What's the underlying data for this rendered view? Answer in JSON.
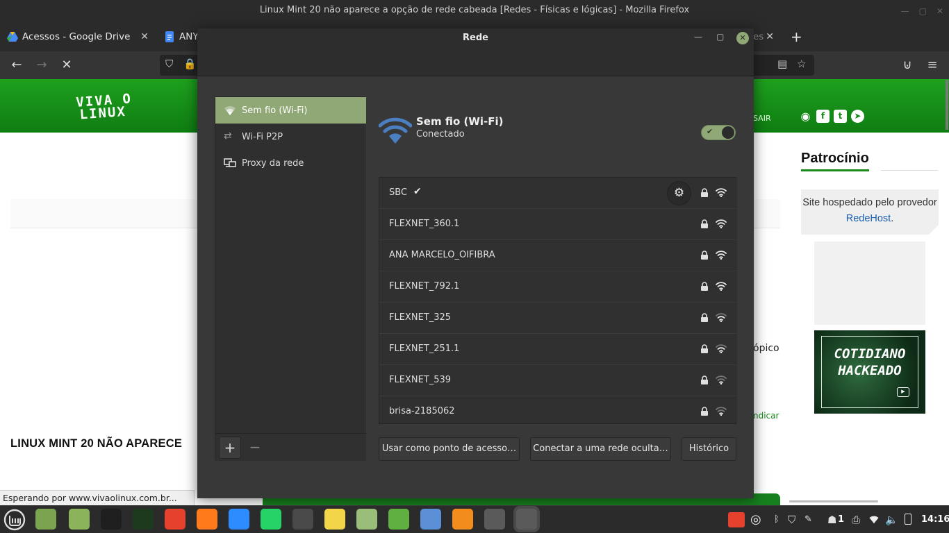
{
  "firefox": {
    "window_title": "Linux Mint 20 não aparece a opção de rede cabeada [Redes - Físicas e lógicas] - Mozilla Firefox",
    "tabs": [
      {
        "label": "Acessos - Google Drive"
      },
      {
        "label": "ANY"
      },
      {
        "label": "es"
      }
    ],
    "new_tab": "+",
    "status_text": "Esperando por www.vivaolinux.com.br..."
  },
  "site": {
    "logo_line1": "VIVA O",
    "logo_line2": "LINUX",
    "sair": "SAIR",
    "topico": "ópico",
    "indicar": "ndicar",
    "article_title": "LINUX MINT 20 NÃO APARECE",
    "sponsor_title": "Patrocínio",
    "sponsor_text": "Site hospedado pelo provedor",
    "sponsor_link": "RedeHost",
    "sponsor_dot": ".",
    "ad_line1": "COTIDIANO",
    "ad_line2": "HACKEADO"
  },
  "dialog": {
    "title": "Rede",
    "sidebar": [
      {
        "label": "Sem fio (Wi-Fi)",
        "icon": "wifi-icon",
        "selected": true
      },
      {
        "label": "Wi-Fi P2P",
        "icon": "p2p-arrows-icon",
        "selected": false
      },
      {
        "label": "Proxy da rede",
        "icon": "proxy-icon",
        "selected": false
      }
    ],
    "add_label": "+",
    "remove_label": "−",
    "connection": {
      "title": "Sem fio (Wi-Fi)",
      "status": "Conectado",
      "enabled": true
    },
    "networks": [
      {
        "name": "SBC",
        "connected": true,
        "locked": true,
        "signal": 4
      },
      {
        "name": "FLEXNET_360.1",
        "connected": false,
        "locked": true,
        "signal": 4
      },
      {
        "name": "ANA MARCELO_OIFIBRA",
        "connected": false,
        "locked": true,
        "signal": 4
      },
      {
        "name": "FLEXNET_792.1",
        "connected": false,
        "locked": true,
        "signal": 4
      },
      {
        "name": "FLEXNET_325",
        "connected": false,
        "locked": true,
        "signal": 3
      },
      {
        "name": "FLEXNET_251.1",
        "connected": false,
        "locked": true,
        "signal": 3
      },
      {
        "name": "FLEXNET_539",
        "connected": false,
        "locked": true,
        "signal": 2
      },
      {
        "name": "brisa-2185062",
        "connected": false,
        "locked": true,
        "signal": 2
      }
    ],
    "buttons": {
      "hotspot": "Usar como ponto de acesso…",
      "hidden": "Conectar a uma rede oculta…",
      "history": "Histórico"
    }
  },
  "taskbar": {
    "apps": [
      {
        "name": "files-icon",
        "color": "#7aa450"
      },
      {
        "name": "files-icon",
        "color": "#8bb35c"
      },
      {
        "name": "terminal-icon",
        "color": "#1f1f1f"
      },
      {
        "name": "system-monitor-icon",
        "color": "#1e3a1e"
      },
      {
        "name": "anydesk-icon",
        "color": "#e5412d"
      },
      {
        "name": "firefox-icon",
        "color": "#ff7a1a"
      },
      {
        "name": "zoom-icon",
        "color": "#2d8cff"
      },
      {
        "name": "whatsapp-icon",
        "color": "#25d366"
      },
      {
        "name": "sublime-icon",
        "color": "#4a4a4a"
      },
      {
        "name": "sticky-notes-icon",
        "color": "#f3d54a"
      },
      {
        "name": "settings-toggle-icon",
        "color": "#9bbd7a"
      },
      {
        "name": "chip-icon",
        "color": "#5fb040"
      },
      {
        "name": "mail-icon",
        "color": "#5b8fd6"
      },
      {
        "name": "slides-icon",
        "color": "#f28c1c"
      },
      {
        "name": "network-icon",
        "color": "#5a5a5a"
      },
      {
        "name": "network-icon",
        "color": "#5a5a5a"
      }
    ],
    "notifications_count": "1",
    "time": "14:16"
  }
}
